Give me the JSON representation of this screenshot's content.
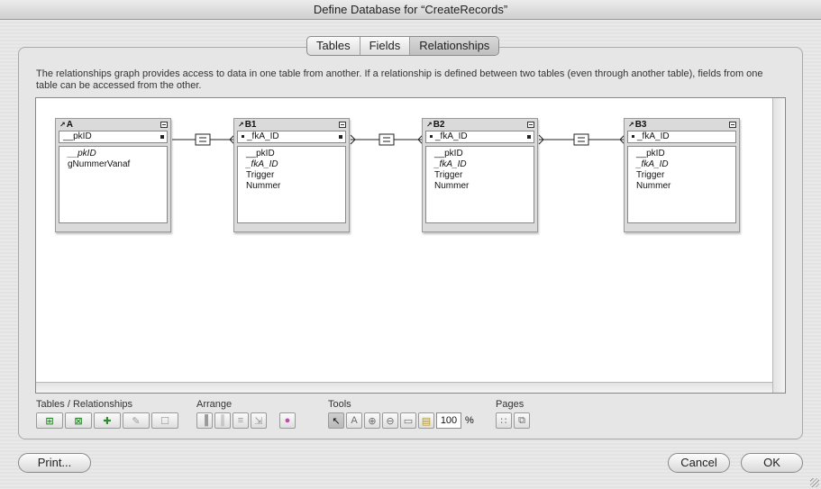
{
  "window": {
    "title": "Define Database for “CreateRecords”"
  },
  "tabs": [
    {
      "label": "Tables",
      "active": false
    },
    {
      "label": "Fields",
      "active": false
    },
    {
      "label": "Relationships",
      "active": true
    }
  ],
  "description": "The relationships graph provides access to data in one table from another. If a relationship is defined between two tables (even through another table), fields from one table can be accessed from the other.",
  "graph": {
    "tables": [
      {
        "name": "A",
        "key": "__pkID",
        "fields": [
          "__pkID",
          "gNummerVanaf"
        ],
        "italic": [
          0
        ]
      },
      {
        "name": "B1",
        "key": "_fkA_ID",
        "fields": [
          "__pkID",
          "_fkA_ID",
          "Trigger",
          "Nummer"
        ],
        "italic": [
          1
        ]
      },
      {
        "name": "B2",
        "key": "_fkA_ID",
        "fields": [
          "__pkID",
          "_fkA_ID",
          "Trigger",
          "Nummer"
        ],
        "italic": [
          1
        ]
      },
      {
        "name": "B3",
        "key": "_fkA_ID",
        "fields": [
          "__pkID",
          "_fkA_ID",
          "Trigger",
          "Nummer"
        ],
        "italic": [
          1
        ]
      }
    ],
    "join_operator": "="
  },
  "toolbar": {
    "tables_relationships_label": "Tables / Relationships",
    "arrange_label": "Arrange",
    "tools_label": "Tools",
    "pages_label": "Pages",
    "zoom_value": "100",
    "zoom_unit": "%"
  },
  "buttons": {
    "print": "Print...",
    "cancel": "Cancel",
    "ok": "OK"
  }
}
